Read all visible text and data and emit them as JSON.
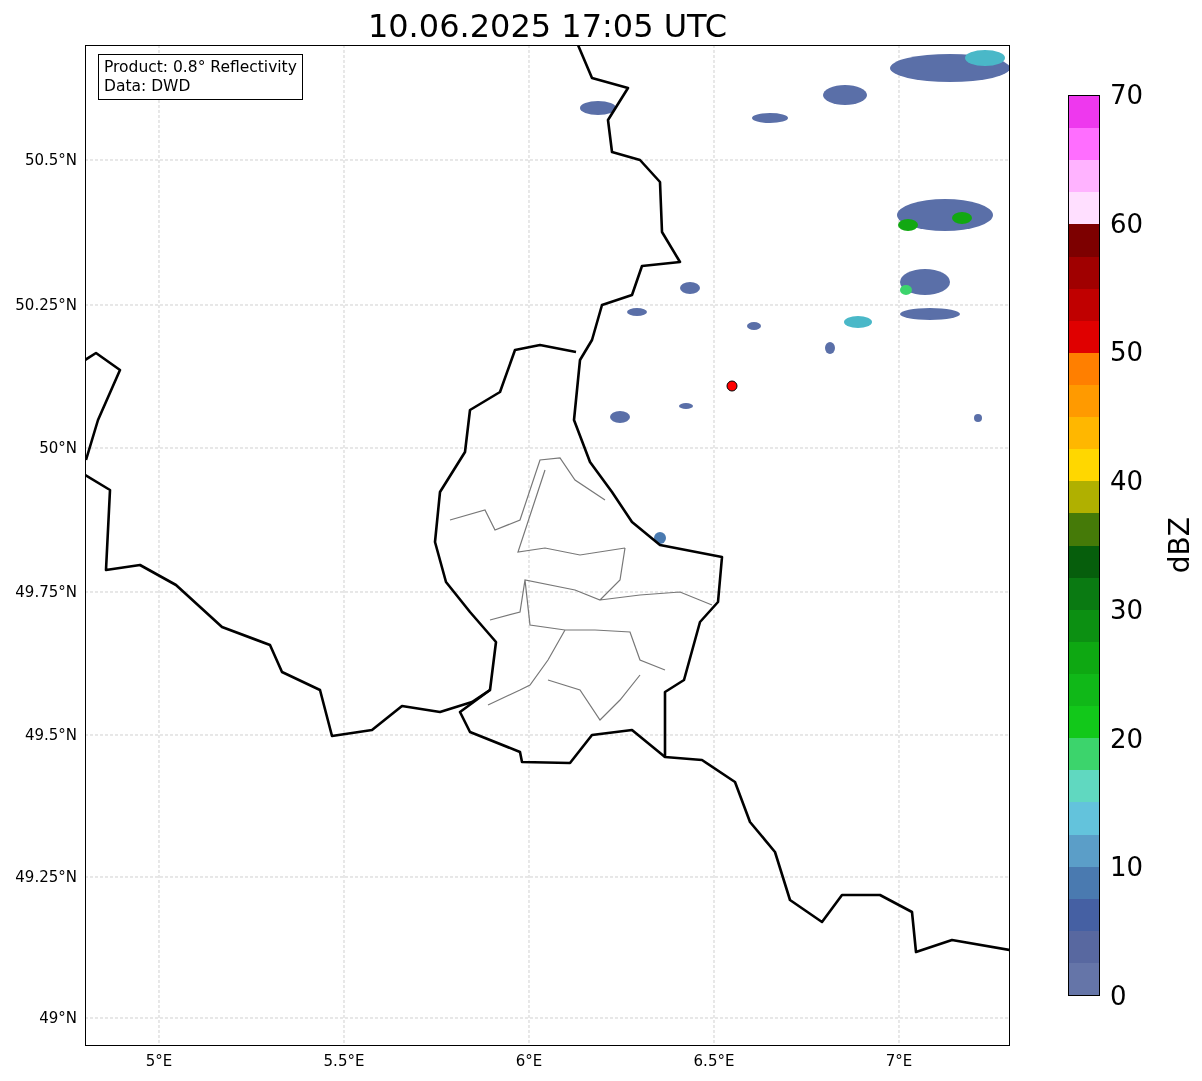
{
  "title": "10.06.2025 17:05 UTC",
  "info_box": [
    "Product: 0.8° Reflectivity",
    "Data: DWD"
  ],
  "map": {
    "lat_labels": [
      "50.5°N",
      "50.25°N",
      "50°N",
      "49.75°N",
      "49.5°N",
      "49.25°N",
      "49°N"
    ],
    "lon_labels": [
      "5°E",
      "5.5°E",
      "6°E",
      "6.5°E",
      "7°E"
    ]
  },
  "colorbar": {
    "label": "dBZ",
    "ticks": [
      "70",
      "60",
      "50",
      "40",
      "30",
      "20",
      "10",
      "0"
    ],
    "bands": [
      {
        "color": "#ee38ee"
      },
      {
        "color": "#ff6eff"
      },
      {
        "color": "#ffb3ff"
      },
      {
        "color": "#ffdfff"
      },
      {
        "color": "#7d0000"
      },
      {
        "color": "#a00000"
      },
      {
        "color": "#c00000"
      },
      {
        "color": "#e00000"
      },
      {
        "color": "#ff7f00"
      },
      {
        "color": "#ff9a00"
      },
      {
        "color": "#ffb700"
      },
      {
        "color": "#ffd700"
      },
      {
        "color": "#b0b000"
      },
      {
        "color": "#457a08"
      },
      {
        "color": "#065e0c"
      },
      {
        "color": "#0a7a12"
      },
      {
        "color": "#0c9012"
      },
      {
        "color": "#0ea812"
      },
      {
        "color": "#10b818"
      },
      {
        "color": "#12c81a"
      },
      {
        "color": "#3cd46c"
      },
      {
        "color": "#60d8c0"
      },
      {
        "color": "#63c3dc"
      },
      {
        "color": "#5b9ec8"
      },
      {
        "color": "#4a7ab0"
      },
      {
        "color": "#4560a3"
      },
      {
        "color": "#5868a0"
      },
      {
        "color": "#6575a8"
      }
    ]
  }
}
